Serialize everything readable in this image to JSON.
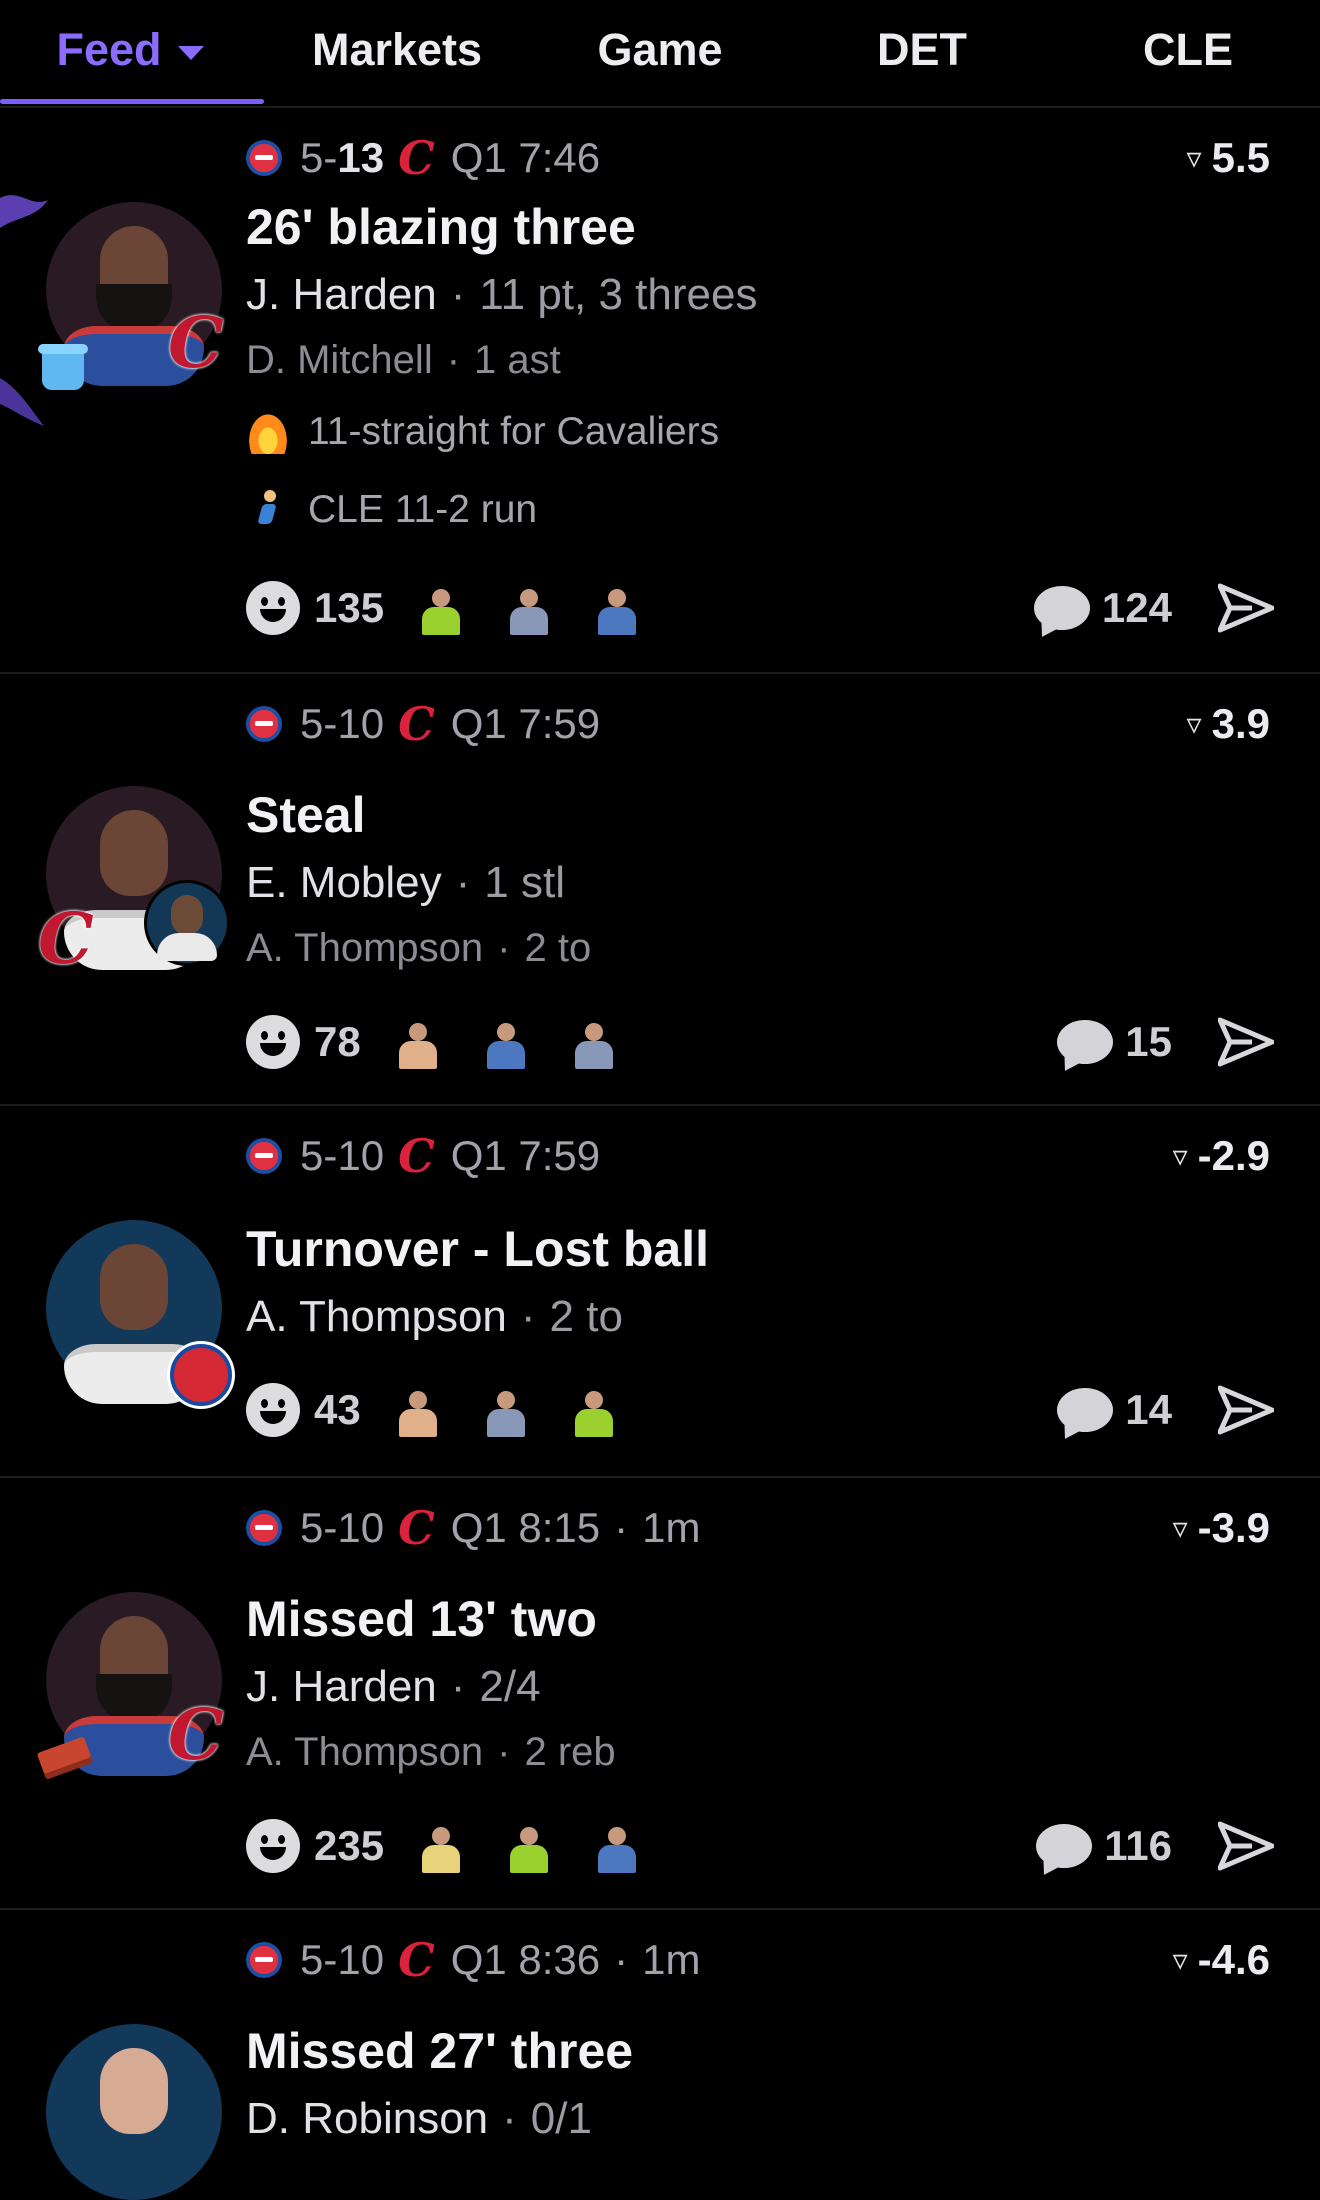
{
  "tabs": {
    "feed": "Feed",
    "markets": "Markets",
    "game": "Game",
    "det": "DET",
    "cle": "CLE"
  },
  "colors": {
    "accent": "#8b6cff",
    "cavs": "#c2182f",
    "pistons": "#d52a36"
  },
  "feed": [
    {
      "score_left": "5-",
      "score_right": "13",
      "time": "Q1 7:46",
      "ago": "",
      "odds": "5.5",
      "title": "26' blazing three",
      "player": "J. Harden",
      "player_stat": "11 pt, 3 threes",
      "assist": "D. Mitchell",
      "assist_stat": "1 ast",
      "streaks": [
        "11-straight for Cavaliers",
        "CLE 11-2 run"
      ],
      "reactions": "135",
      "comments": "124"
    },
    {
      "score_left": "5-10",
      "time": "Q1 7:59",
      "odds": "3.9",
      "title": "Steal",
      "player": "E. Mobley",
      "player_stat": "1 stl",
      "assist": "A. Thompson",
      "assist_stat": "2 to",
      "reactions": "78",
      "comments": "15"
    },
    {
      "score_left": "5-10",
      "time": "Q1 7:59",
      "odds": "-2.9",
      "title": "Turnover - Lost ball",
      "player": "A. Thompson",
      "player_stat": "2 to",
      "reactions": "43",
      "comments": "14"
    },
    {
      "score_left": "5-10",
      "time": "Q1 8:15",
      "ago": "1m",
      "odds": "-3.9",
      "title": "Missed 13' two",
      "player": "J. Harden",
      "player_stat": "2/4",
      "assist": "A. Thompson",
      "assist_stat": "2 reb",
      "reactions": "235",
      "comments": "116"
    },
    {
      "score_left": "5-10",
      "time": "Q1 8:36",
      "ago": "1m",
      "odds": "-4.6",
      "title": "Missed 27' three",
      "player": "D. Robinson",
      "player_stat": "0/1"
    }
  ]
}
